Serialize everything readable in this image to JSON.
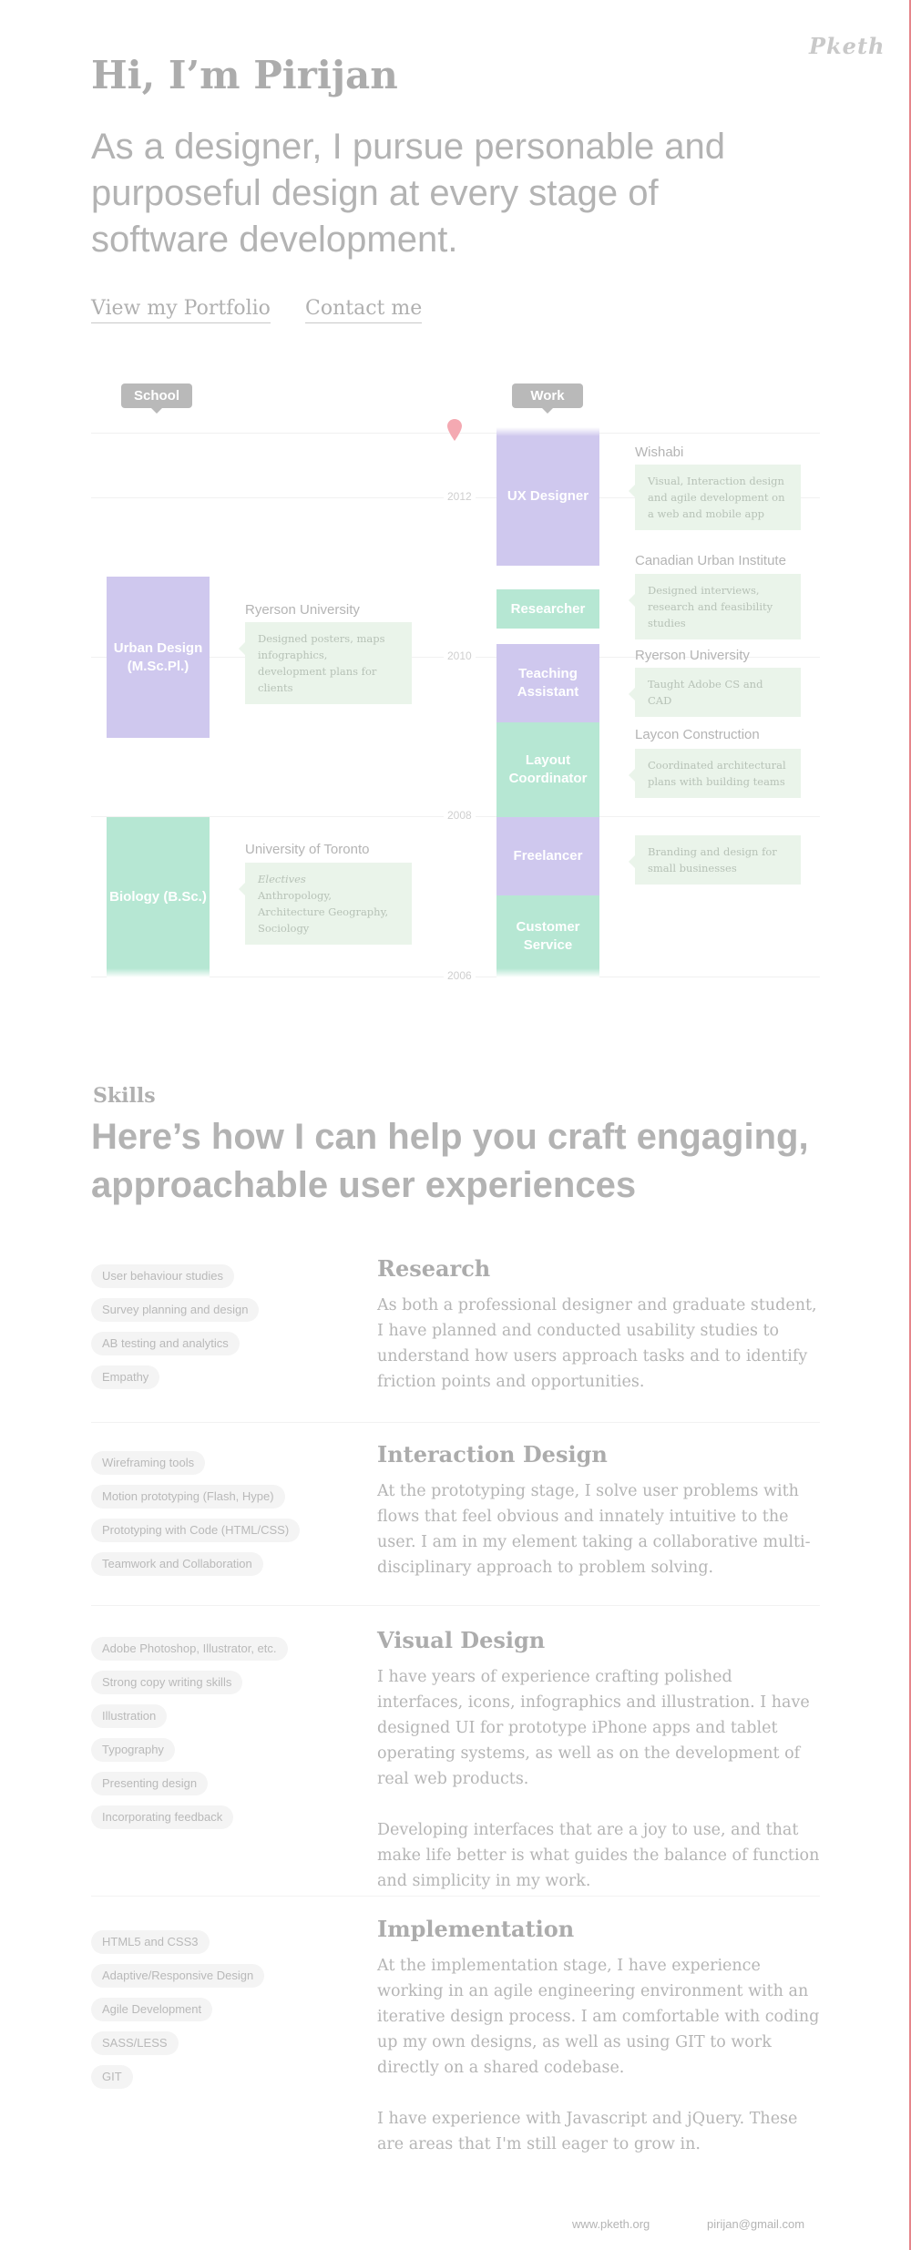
{
  "brand": {
    "logo": "Pketh"
  },
  "intro": {
    "greeting": "Hi, I’m Pirijan",
    "tagline": "As a designer, I pursue personable and purposeful design at every stage of software development.",
    "links": {
      "portfolio": "View my Portfolio",
      "contact": "Contact me"
    }
  },
  "timeline": {
    "labels": {
      "school": "School",
      "work": "Work"
    },
    "years": [
      "2012",
      "2010",
      "2008",
      "2006"
    ],
    "school": [
      {
        "block": "Urban Design (M.Sc.Pl.)",
        "color": "purple",
        "org": "Ryerson University",
        "note": "Designed posters, maps infographics, development plans for clients",
        "note_label": ""
      },
      {
        "block": "Biology (B.Sc.)",
        "color": "green",
        "org": "University of Toronto",
        "note": "Anthropology, Architecture Geography, Sociology",
        "note_label": "Electives"
      }
    ],
    "work": [
      {
        "block": "UX Designer",
        "color": "purple",
        "org": "Wishabi",
        "note": "Visual, Interaction design and agile development on a web and mobile app"
      },
      {
        "block": "Researcher",
        "color": "green",
        "org": "Canadian Urban Institute",
        "note": "Designed interviews, research and feasibility studies"
      },
      {
        "block": "Teaching Assistant",
        "color": "purple",
        "org": "Ryerson University",
        "note": "Taught Adobe CS and CAD"
      },
      {
        "block": "Layout Coordinator",
        "color": "green",
        "org": "Laycon Construction",
        "note": "Coordinated architectural plans with building teams"
      },
      {
        "block": "Freelancer",
        "color": "purple",
        "org": "",
        "note": "Branding and design for small businesses"
      },
      {
        "block": "Customer Service",
        "color": "green",
        "org": "",
        "note": ""
      }
    ]
  },
  "skills": {
    "kicker": "Skills",
    "heading": "Here’s how I can help you craft engaging, approachable user experiences",
    "sections": [
      {
        "title": "Research",
        "chips": [
          "User behaviour studies",
          "Survey planning and design",
          "AB testing and analytics",
          "Empathy"
        ],
        "paragraphs": [
          "As both a professional designer and graduate student, I have planned and conducted usability studies to understand how users approach tasks and to identify friction points and opportunities."
        ]
      },
      {
        "title": "Interaction Design",
        "chips": [
          "Wireframing tools",
          "Motion prototyping (Flash, Hype)",
          "Prototyping with Code (HTML/CSS)",
          "Teamwork and Collaboration"
        ],
        "paragraphs": [
          "At the prototyping stage, I solve user problems with flows that feel obvious and innately intuitive to the user. I am in my element taking a  collaborative multi-disciplinary approach to problem solving."
        ]
      },
      {
        "title": "Visual Design",
        "chips": [
          "Adobe Photoshop, Illustrator, etc.",
          "Strong copy writing skills",
          "Illustration",
          "Typography",
          "Presenting design",
          "Incorporating feedback"
        ],
        "paragraphs": [
          "I have years of experience crafting polished interfaces, icons, infographics and illustration. I have designed UI for prototype iPhone apps and tablet operating systems, as well as on the development of real web products.",
          "Developing interfaces that are a joy to use, and that make life better is what guides the balance of function and simplicity in my work."
        ]
      },
      {
        "title": "Implementation",
        "chips": [
          "HTML5 and CSS3",
          "Adaptive/Responsive Design",
          "Agile Development",
          "SASS/LESS",
          "GIT"
        ],
        "paragraphs": [
          "At the implementation stage, I have experience working in an agile engineering environment with an iterative design process. I am comfortable with coding up my own designs, as well as using GIT to work directly on a shared codebase.",
          "I have experience with Javascript and jQuery. These are areas that I'm still eager to grow in."
        ]
      }
    ]
  },
  "footer": {
    "site": "www.pketh.org",
    "email": "pirijan@gmail.com"
  },
  "colors": {
    "purple": "#cfc8ee",
    "green": "#b6e7d3",
    "note_bg": "#eaf4ea",
    "accent_line": "#e5858b",
    "pin": "#f4a9b2"
  }
}
